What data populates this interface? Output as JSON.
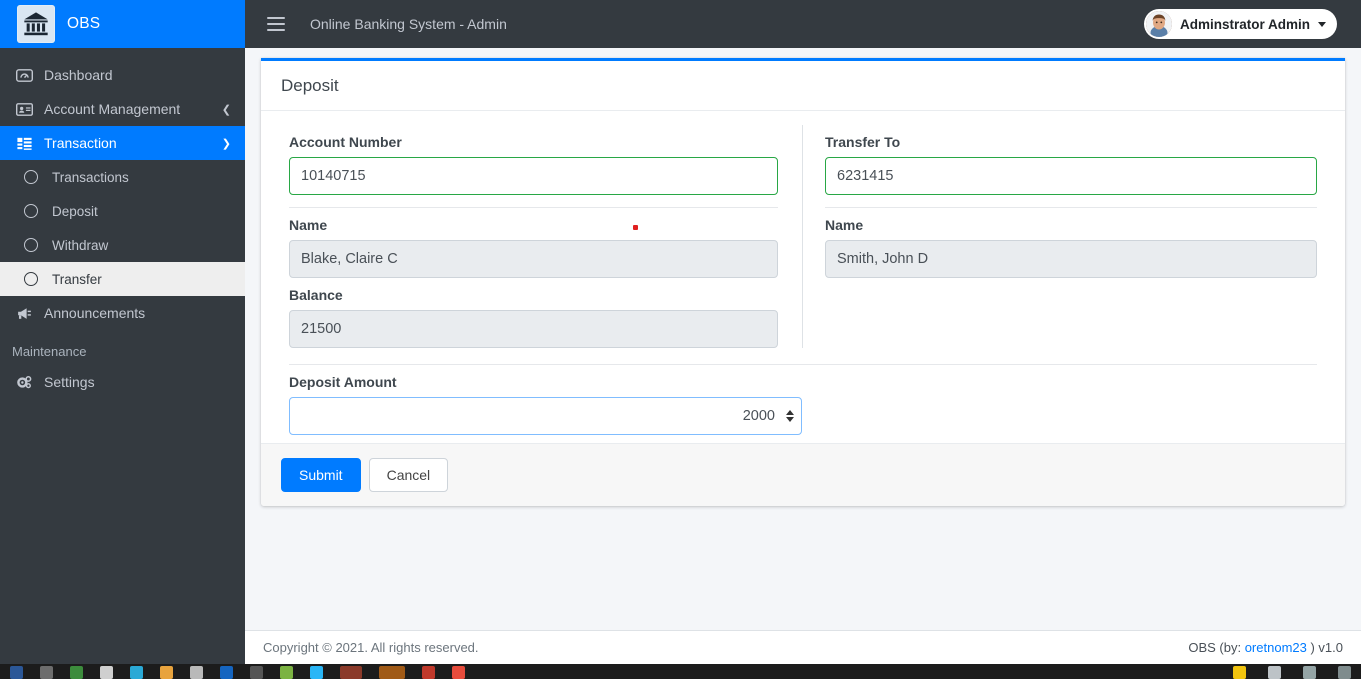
{
  "brand": {
    "title": "OBS",
    "logo_icon": "bank-icon"
  },
  "navbar": {
    "menu_icon": "hamburger-icon",
    "title": "Online Banking System - Admin",
    "user_name": "Adminstrator Admin",
    "avatar_icon": "user-avatar",
    "caret_icon": "chevron-down-icon"
  },
  "sidebar": {
    "items": [
      {
        "label": "Dashboard",
        "icon": "dashboard-icon",
        "active": false,
        "arrow": ""
      },
      {
        "label": "Account Management",
        "icon": "id-card-icon",
        "active": false,
        "arrow": "chevron-left-icon"
      },
      {
        "label": "Transaction",
        "icon": "table-list-icon",
        "active": true,
        "arrow": "chevron-down-icon"
      }
    ],
    "sub_items": [
      {
        "label": "Transactions",
        "icon": "circle-icon",
        "active": false
      },
      {
        "label": "Deposit",
        "icon": "circle-icon",
        "active": false
      },
      {
        "label": "Withdraw",
        "icon": "circle-icon",
        "active": false
      },
      {
        "label": "Transfer",
        "icon": "circle-icon",
        "active": true
      }
    ],
    "announcements": {
      "label": "Announcements",
      "icon": "bullhorn-icon"
    },
    "maintenance_header": "Maintenance",
    "settings": {
      "label": "Settings",
      "icon": "gears-icon"
    }
  },
  "card": {
    "title": "Deposit",
    "accent_color": "#007bff"
  },
  "form": {
    "account_number": {
      "label": "Account Number",
      "value": "10140715",
      "placeholder": "",
      "state": "valid"
    },
    "transfer_to": {
      "label": "Transfer To",
      "value": "6231415",
      "placeholder": "",
      "state": "valid"
    },
    "name_left": {
      "label": "Name",
      "value": "Blake, Claire C",
      "readonly": true
    },
    "name_right": {
      "label": "Name",
      "value": "Smith, John D",
      "readonly": true
    },
    "balance": {
      "label": "Balance",
      "value": "21500",
      "readonly": true
    },
    "deposit_amount": {
      "label": "Deposit Amount",
      "value": "2000",
      "placeholder": "",
      "state": "focused",
      "spinner_up_icon": "spinner-up-icon",
      "spinner_down_icon": "spinner-down-icon"
    },
    "marker_icon": "red-dot-marker"
  },
  "actions": {
    "submit_label": "Submit",
    "cancel_label": "Cancel"
  },
  "footer": {
    "copyright": "Copyright © 2021. All rights reserved.",
    "right_prefix": "OBS (by:",
    "right_link": "oretnom23",
    "right_suffix": ") v1.0"
  }
}
